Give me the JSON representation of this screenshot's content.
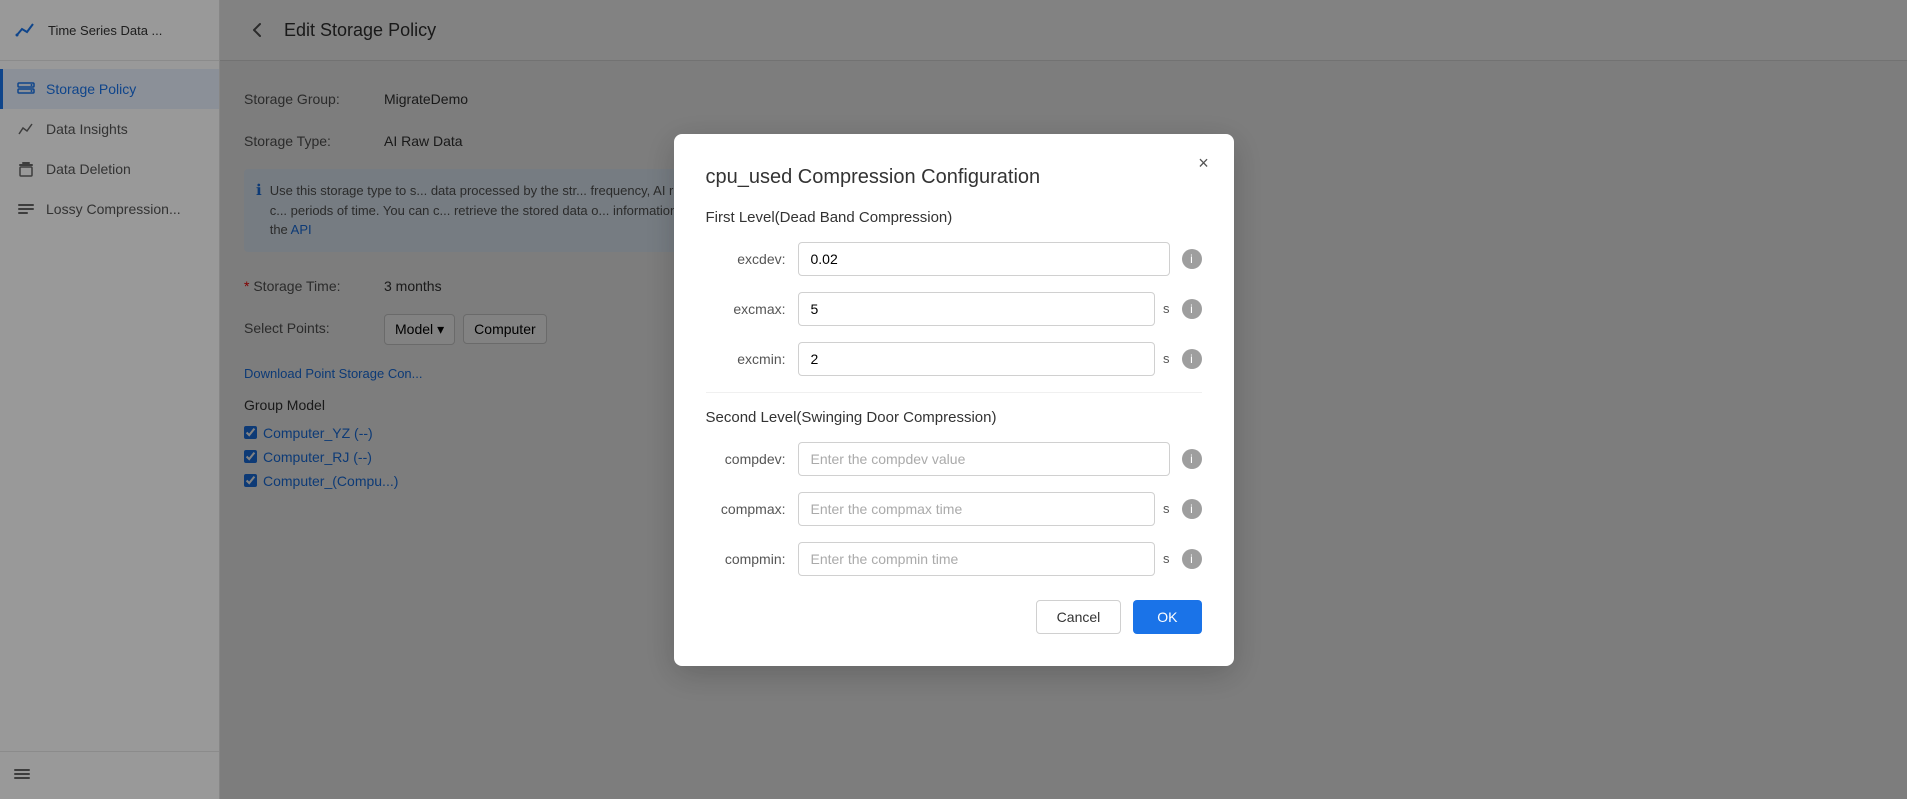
{
  "sidebar": {
    "app_title": "Time Series Data ...",
    "items": [
      {
        "id": "storage-policy",
        "label": "Storage Policy",
        "active": true
      },
      {
        "id": "data-insights",
        "label": "Data Insights",
        "active": false
      },
      {
        "id": "data-deletion",
        "label": "Data Deletion",
        "active": false
      },
      {
        "id": "lossy-compression",
        "label": "Lossy Compression...",
        "active": false
      }
    ],
    "footer_icon": "menu"
  },
  "main": {
    "page_title": "Edit Storage Policy",
    "storage_group_label": "Storage Group:",
    "storage_group_value": "MigrateDemo",
    "storage_type_label": "Storage Type:",
    "storage_type_value": "AI Raw Data",
    "info_text_partial": "Use this storage type to s... data processed by the str... frequency, AI raw data is c... periods of time. You can c... retrieve the stored data o... information, view the",
    "info_api_link": "API",
    "storage_time_label": "Storage Time:",
    "storage_time_value": "3 months",
    "select_points_label": "Select Points:",
    "select_model_label": "Model",
    "select_computer_label": "Computer",
    "download_link": "Download Point Storage Con...",
    "group_model_header": "Group Model",
    "checkboxes": [
      {
        "label": "Computer_YZ (--)",
        "checked": true
      },
      {
        "label": "Computer_RJ (--)",
        "checked": true
      },
      {
        "label": "Computer_(Compu...)",
        "checked": true
      }
    ]
  },
  "modal": {
    "title": "cpu_used Compression Configuration",
    "close_label": "×",
    "first_level_title": "First Level(Dead Band Compression)",
    "fields_first": [
      {
        "id": "excdev",
        "label": "excdev:",
        "value": "0.02",
        "placeholder": "",
        "suffix": "",
        "show_suffix": false
      },
      {
        "id": "excmax",
        "label": "excmax:",
        "value": "5",
        "placeholder": "",
        "suffix": "s",
        "show_suffix": true
      },
      {
        "id": "excmin",
        "label": "excmin:",
        "value": "2",
        "placeholder": "",
        "suffix": "s",
        "show_suffix": true
      }
    ],
    "second_level_title": "Second Level(Swinging Door Compression)",
    "fields_second": [
      {
        "id": "compdev",
        "label": "compdev:",
        "value": "",
        "placeholder": "Enter the compdev value",
        "suffix": "",
        "show_suffix": false
      },
      {
        "id": "compmax",
        "label": "compmax:",
        "value": "",
        "placeholder": "Enter the compmax time",
        "suffix": "s",
        "show_suffix": true
      },
      {
        "id": "compmin",
        "label": "compmin:",
        "value": "",
        "placeholder": "Enter the compmin time",
        "suffix": "s",
        "show_suffix": true
      }
    ],
    "cancel_label": "Cancel",
    "ok_label": "OK"
  }
}
